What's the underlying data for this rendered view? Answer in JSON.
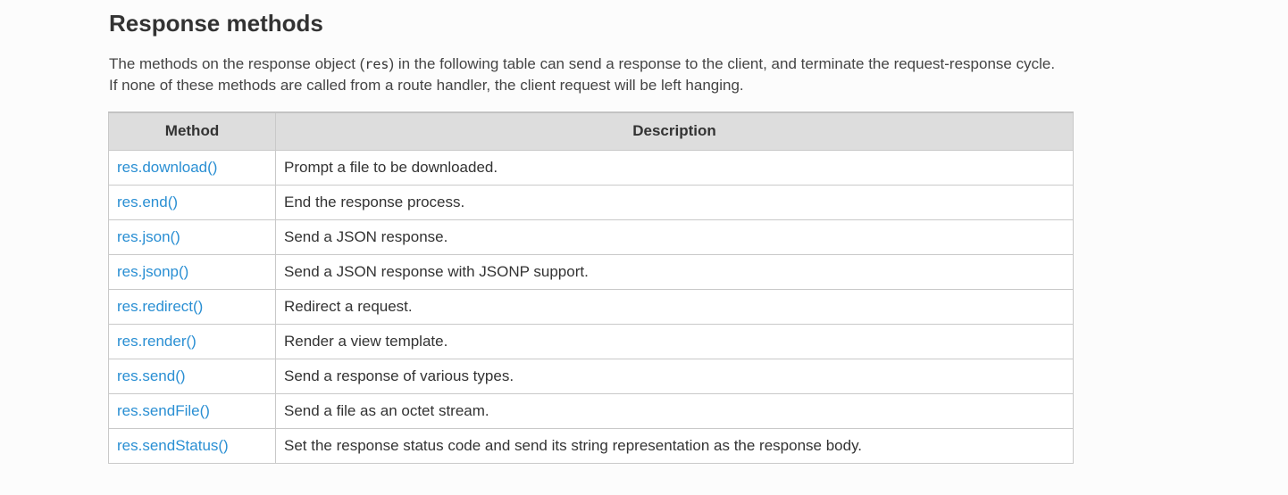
{
  "heading": "Response methods",
  "intro": {
    "before": "The methods on the response object (",
    "code": "res",
    "after": ") in the following table can send a response to the client, and terminate the request-response cycle. If none of these methods are called from a route handler, the client request will be left hanging."
  },
  "table": {
    "headers": [
      "Method",
      "Description"
    ],
    "rows": [
      {
        "method": "res.download()",
        "description": "Prompt a file to be downloaded."
      },
      {
        "method": "res.end()",
        "description": "End the response process."
      },
      {
        "method": "res.json()",
        "description": "Send a JSON response."
      },
      {
        "method": "res.jsonp()",
        "description": "Send a JSON response with JSONP support."
      },
      {
        "method": "res.redirect()",
        "description": "Redirect a request."
      },
      {
        "method": "res.render()",
        "description": "Render a view template."
      },
      {
        "method": "res.send()",
        "description": "Send a response of various types."
      },
      {
        "method": "res.sendFile()",
        "description": "Send a file as an octet stream."
      },
      {
        "method": "res.sendStatus()",
        "description": "Set the response status code and send its string representation as the response body."
      }
    ]
  },
  "colors": {
    "link": "#2a8fd3",
    "header_bg": "#dddddd",
    "border": "#c9c9c9",
    "text": "#333333"
  }
}
